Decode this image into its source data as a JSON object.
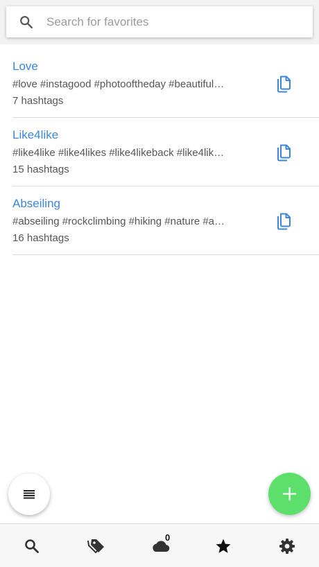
{
  "search": {
    "placeholder": "Search for favorites",
    "value": ""
  },
  "favorites": [
    {
      "title": "Love",
      "hashtags": "#love #instagood #photooftheday #beautiful…",
      "count": "7 hashtags"
    },
    {
      "title": "Like4like",
      "hashtags": "#like4like #like4likes #like4likeback #like4lik…",
      "count": "15 hashtags"
    },
    {
      "title": "Abseiling",
      "hashtags": "#abseiling #rockclimbing #hiking #nature #a…",
      "count": "16 hashtags"
    }
  ],
  "nav": {
    "items": [
      {
        "icon": "search-icon"
      },
      {
        "icon": "tags-icon"
      },
      {
        "icon": "cloud-icon",
        "badge": "0"
      },
      {
        "icon": "star-icon",
        "active": true
      },
      {
        "icon": "gear-icon"
      }
    ]
  },
  "colors": {
    "accent": "#3b86d8",
    "fab_add": "#5ddf6b",
    "text_secondary": "#555555",
    "icon_dark": "#333333"
  }
}
